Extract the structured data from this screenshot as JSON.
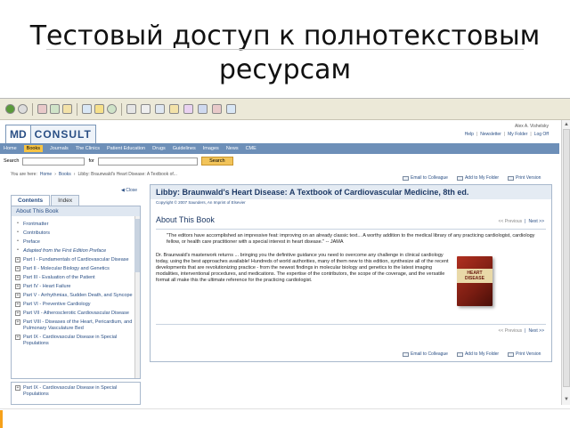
{
  "slide": {
    "title_line1": "Тестовый доступ к полнотекстовым",
    "title_line2": "ресурсам"
  },
  "header": {
    "logo_md": "MD",
    "logo_consult": "CONSULT",
    "user": "Alex A. Vishelsky",
    "links": [
      "Help",
      "Newsletter",
      "My Folder",
      "Log Off"
    ]
  },
  "nav": {
    "items": [
      "Home",
      "Books",
      "Journals",
      "The Clinics",
      "Patient Education",
      "Drugs",
      "Guidelines",
      "Images",
      "News",
      "CME"
    ],
    "active": "Books"
  },
  "search": {
    "label": "Search",
    "for_label": "for",
    "button": "Search"
  },
  "breadcrumb": {
    "prefix": "You are here:",
    "items": [
      "Home",
      "Books",
      "Libby: Braunwald's Heart Disease: A Textbook of..."
    ]
  },
  "sidebar": {
    "close": "◀ Close",
    "tabs": [
      "Contents",
      "Index"
    ],
    "active_tab": "Contents",
    "heading": "About This Book",
    "items": [
      {
        "marker": "•",
        "label": "Frontmatter",
        "italic": false
      },
      {
        "marker": "•",
        "label": "Contributors",
        "italic": false
      },
      {
        "marker": "•",
        "label": "Preface",
        "italic": false
      },
      {
        "marker": "•",
        "label": "Adapted from the First Edition Preface",
        "italic": true
      },
      {
        "marker": "+",
        "label": "Part I - Fundamentals of Cardiovascular Disease",
        "italic": false
      },
      {
        "marker": "+",
        "label": "Part II - Molecular Biology and Genetics",
        "italic": false
      },
      {
        "marker": "+",
        "label": "Part III - Evaluation of the Patient",
        "italic": false
      },
      {
        "marker": "+",
        "label": "Part IV - Heart Failure",
        "italic": false
      },
      {
        "marker": "+",
        "label": "Part V - Arrhythmias, Sudden Death, and Syncope",
        "italic": false
      },
      {
        "marker": "+",
        "label": "Part VI - Preventive Cardiology",
        "italic": false
      },
      {
        "marker": "+",
        "label": "Part VII - Atherosclerotic Cardiovascular Disease",
        "italic": false
      },
      {
        "marker": "+",
        "label": "Part VIII - Diseases of the Heart, Pericardium, and Pulmonary Vasculature Bed",
        "italic": false
      },
      {
        "marker": "+",
        "label": "Part IX - Cardiovascular Disease in Special Populations",
        "italic": false
      }
    ],
    "bottom_item": {
      "marker": "+",
      "label": "Part IX - Cardiovascular Disease in Special Populations"
    }
  },
  "utility_links": [
    "Email to Colleague",
    "Add to My Folder",
    "Print Version"
  ],
  "content": {
    "title": "Libby: Braunwald's Heart Disease: A Textbook of Cardiovascular Medicine, 8th ed.",
    "copyright": "Copyright © 2007 Saunders, An Imprint of Elsevier",
    "heading": "About This Book",
    "prev": "<< Previous",
    "sep": "|",
    "next": "Next >>",
    "quote": "\"The editors have accomplished an impressive feat: improving on an already classic text... A worthy addition to the medical library of any practicing cardiologist, cardiology fellow, or health care practitioner with a special interest in heart disease.\" -- JAMA",
    "body": "Dr. Braunwald's masterwork returns ... bringing you the definitive guidance you need to overcome any challenge in clinical cardiology today, using the best approaches available! Hundreds of world authorities, many of them new to this edition, synthesize all of the recent developments that are revolutionizing practice - from the newest findings in molecular biology and genetics to the latest imaging modalities, interventional procedures, and medications. The expertise of the contributors, the scope of the coverage, and the versatile format all make this the ultimate reference for the practicing cardiologist.",
    "book_cover_text": "HEART DISEASE"
  }
}
